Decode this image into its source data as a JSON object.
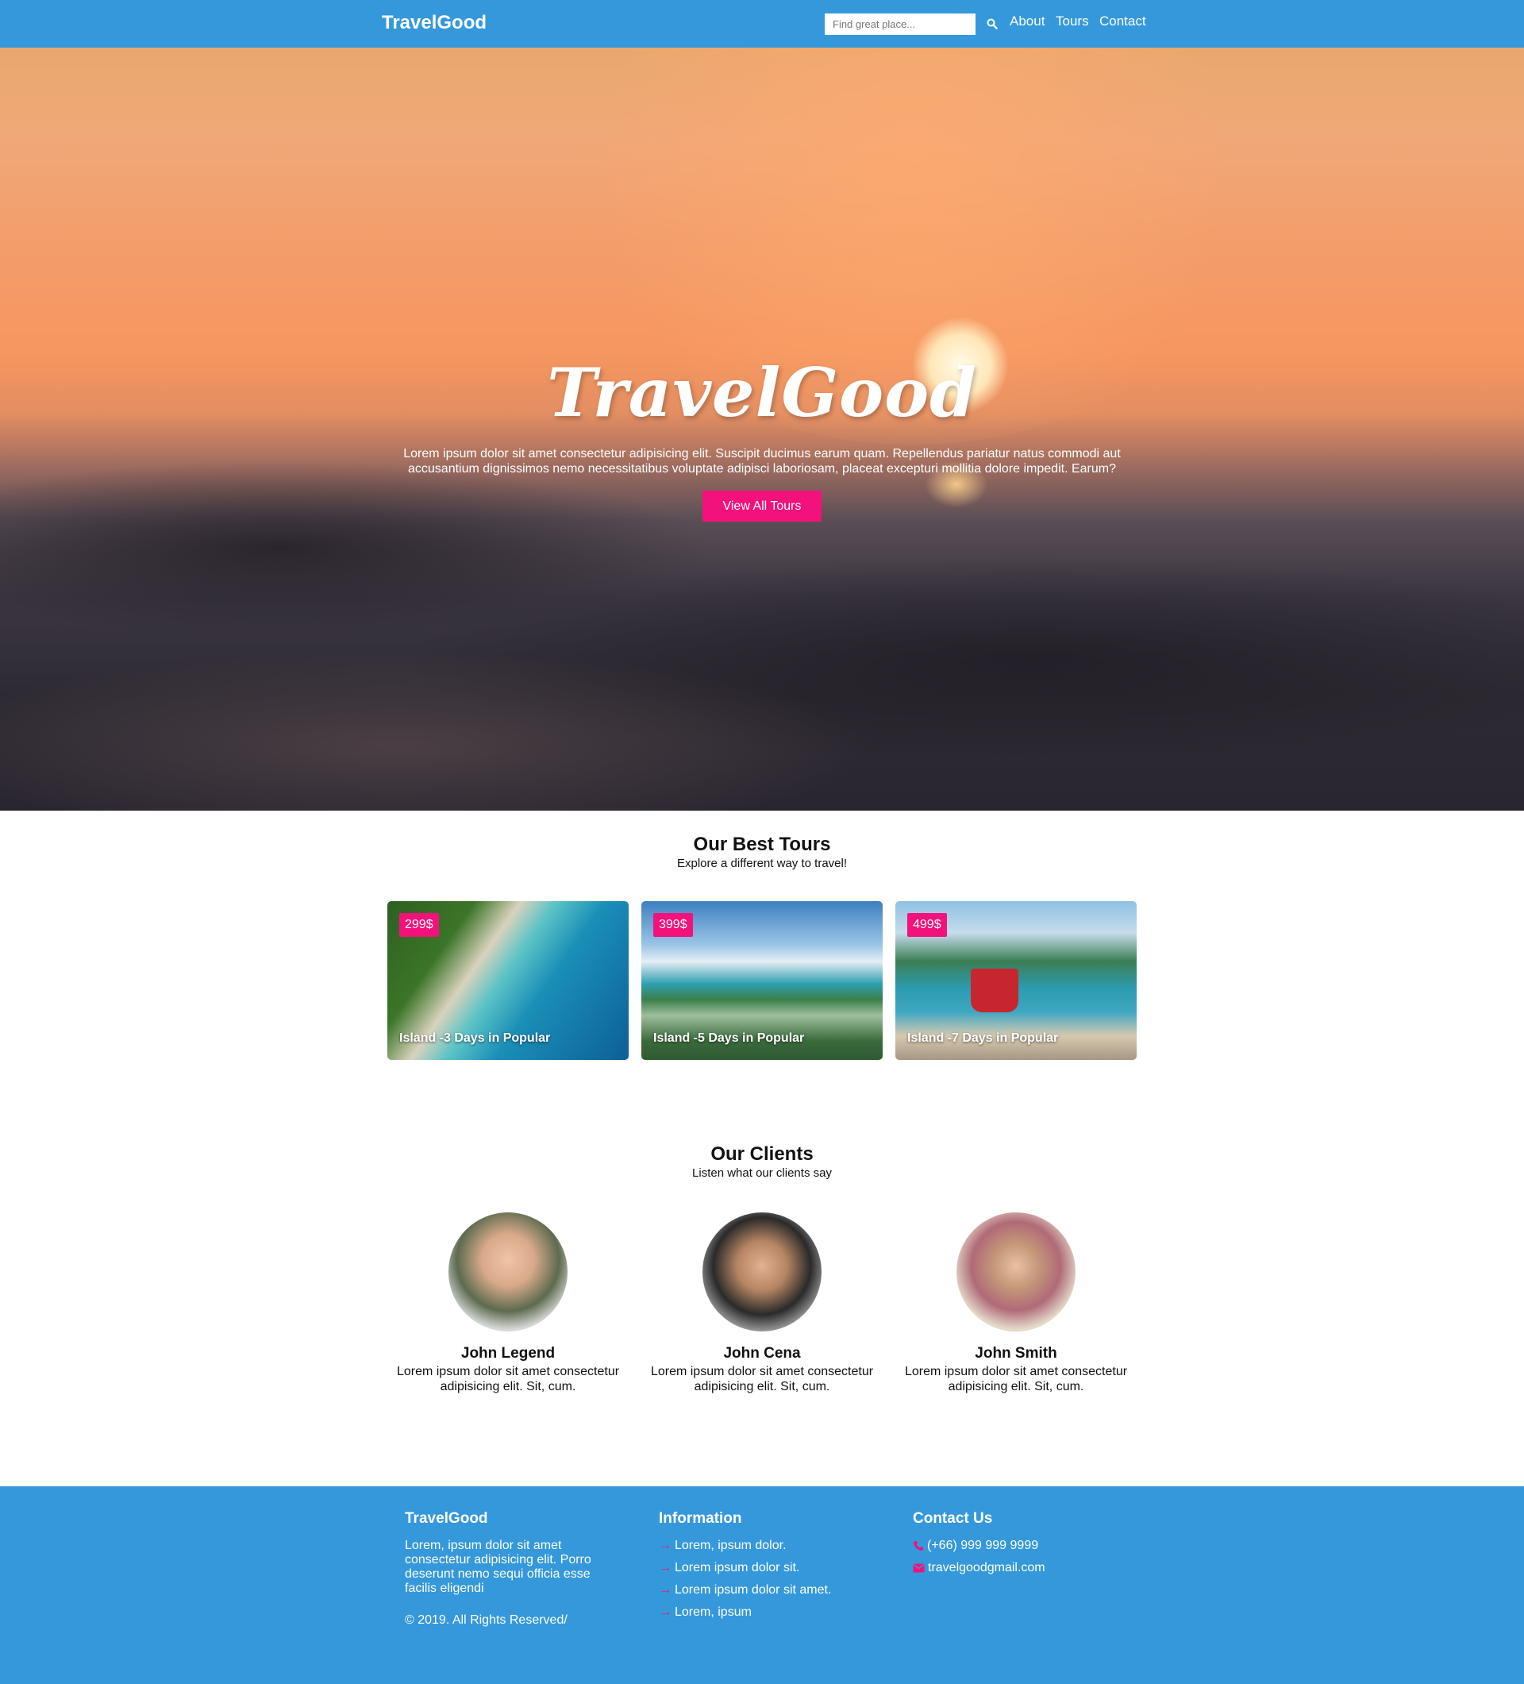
{
  "navbar": {
    "brand": "TravelGood",
    "search_placeholder": "Find great place...",
    "links": [
      "About",
      "Tours",
      "Contact"
    ]
  },
  "hero": {
    "title": "TravelGood",
    "text": "Lorem ipsum dolor sit amet consectetur adipisicing elit. Suscipit ducimus earum quam. Repellendus pariatur natus commodi aut accusantium dignissimos nemo necessitatibus voluptate adipisci laboriosam, placeat excepturi mollitia dolore impedit. Earum?",
    "cta": "View All Tours"
  },
  "tours": {
    "title": "Our Best Tours",
    "subtitle": "Explore a different way to travel!",
    "cards": [
      {
        "price": "299$",
        "label": "Island -3 Days in Popular"
      },
      {
        "price": "399$",
        "label": "Island -5 Days in Popular"
      },
      {
        "price": "499$",
        "label": "Island -7 Days in Popular"
      }
    ]
  },
  "clients": {
    "title": "Our Clients",
    "subtitle": "Listen what our clients say",
    "items": [
      {
        "name": "John Legend",
        "text": "Lorem ipsum dolor sit amet consectetur adipisicing elit. Sit, cum."
      },
      {
        "name": "John Cena",
        "text": "Lorem ipsum dolor sit amet consectetur adipisicing elit. Sit, cum."
      },
      {
        "name": "John Smith",
        "text": "Lorem ipsum dolor sit amet consectetur adipisicing elit. Sit, cum."
      }
    ]
  },
  "footer": {
    "about": {
      "heading": "TravelGood",
      "text": "Lorem, ipsum dolor sit amet consectetur adipisicing elit. Porro deserunt nemo sequi officia esse facilis eligendi",
      "copyright": "© 2019. All Rights Reserved/"
    },
    "info": {
      "heading": "Information",
      "links": [
        "Lorem, ipsum dolor.",
        "Lorem ipsum dolor sit.",
        "Lorem ipsum dolor sit amet.",
        "Lorem, ipsum"
      ]
    },
    "contact": {
      "heading": "Contact Us",
      "phone": "(+66) 999 999 9999",
      "email": "travelgoodgmail.com"
    }
  },
  "colors": {
    "primary": "#3598db",
    "accent": "#f3117b"
  },
  "icons": {
    "search": "search-icon",
    "phone": "phone-icon",
    "email": "envelope-icon",
    "arrow": "arrow-right-icon"
  }
}
